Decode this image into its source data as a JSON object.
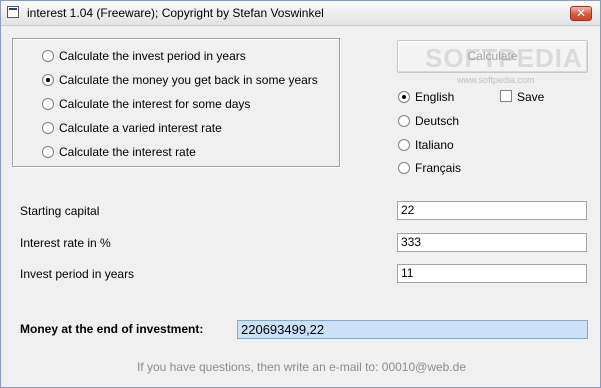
{
  "window": {
    "title": "interest 1.04 (Freeware); Copyright by Stefan Voswinkel",
    "close_glyph": "✕",
    "app_icon": "app-window-icon"
  },
  "calc_options": [
    {
      "label": "Calculate the invest period in years",
      "checked": false
    },
    {
      "label": "Calculate the money you get back in some years",
      "checked": true
    },
    {
      "label": "Calculate the interest for some days",
      "checked": false
    },
    {
      "label": "Calculate a varied interest rate",
      "checked": false
    },
    {
      "label": "Calculate the interest rate",
      "checked": false
    }
  ],
  "calculate_button": {
    "label": "Calculate",
    "enabled": false
  },
  "watermark": {
    "big": "SOFTPEDIA",
    "small": "www.softpedia.com"
  },
  "languages": [
    {
      "label": "English",
      "checked": true
    },
    {
      "label": "Deutsch",
      "checked": false
    },
    {
      "label": "Italiano",
      "checked": false
    },
    {
      "label": "Français",
      "checked": false
    }
  ],
  "save": {
    "label": "Save",
    "checked": false
  },
  "fields": {
    "starting_capital": {
      "label": "Starting capital",
      "value": "22"
    },
    "interest_rate": {
      "label": "Interest rate in %",
      "value": "333"
    },
    "invest_period": {
      "label": "Invest period in years",
      "value": "11"
    }
  },
  "result": {
    "label": "Money at the end of investment:",
    "value": "220693499,22"
  },
  "contact": "If you have questions, then write an e-mail to: 00010@web.de",
  "colors": {
    "result_field_bg": "#cbe1f5",
    "contact_text": "#8c8c8c",
    "window_bg": "#f0f0f0"
  }
}
